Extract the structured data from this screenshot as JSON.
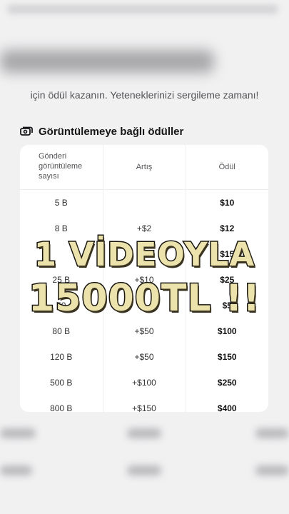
{
  "subtitle": "için ödül kazanın. Yeteneklerinizi sergileme zamanı!",
  "section": {
    "title": "Görüntülemeye bağlı ödüller",
    "icon": "money-icon"
  },
  "table": {
    "headers": [
      "Gönderi görüntüleme sayısı",
      "Artış",
      "Ödül"
    ],
    "rows": [
      [
        "5 B",
        "",
        "$10"
      ],
      [
        "8 B",
        "+$2",
        "$12"
      ],
      [
        "",
        "",
        "$15"
      ],
      [
        "25 B",
        "+$10",
        "$25"
      ],
      [
        "50",
        "",
        "$5"
      ],
      [
        "80 B",
        "+$50",
        "$100"
      ],
      [
        "120 B",
        "+$50",
        "$150"
      ],
      [
        "500 B",
        "+$100",
        "$250"
      ],
      [
        "800 B",
        "+$150",
        "$400"
      ]
    ]
  },
  "overlay": {
    "line1": "1 VİDEOYLA",
    "line2": "15000TL !!"
  },
  "colors": {
    "background": "#f1f1f2",
    "card": "#ffffff",
    "overlay_fill": "#ece2ab",
    "overlay_stroke": "#16140e"
  }
}
